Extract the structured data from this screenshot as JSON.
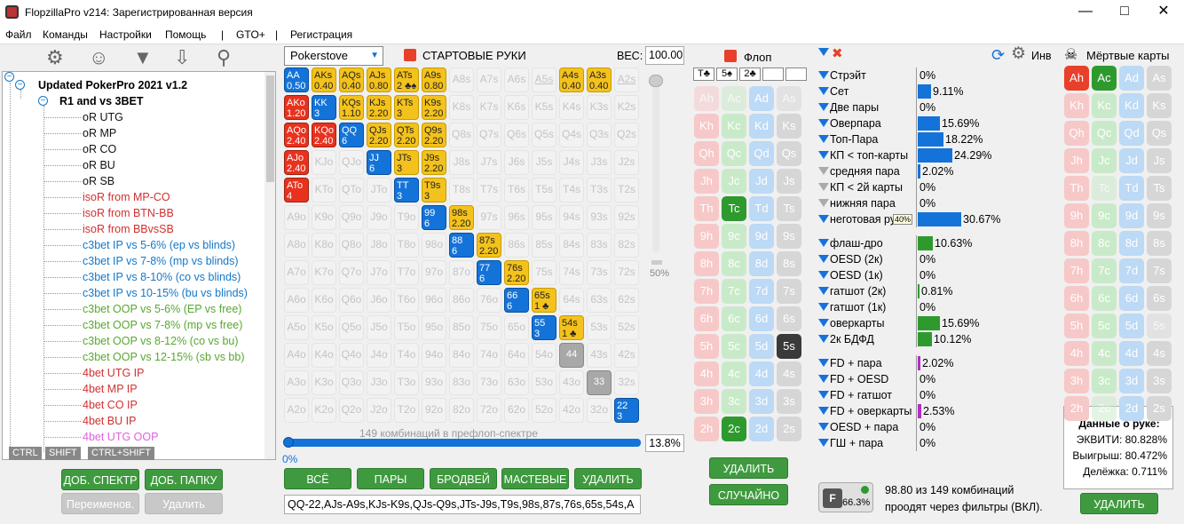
{
  "title": "FlopzillaPro v214: Зарегистрированная версия",
  "menu": [
    "Файл",
    "Команды",
    "Настройки",
    "Помощь",
    "|",
    "GTO+",
    "|",
    "Регистрация"
  ],
  "tree": {
    "root": "Updated PokerPro 2021 v1.2",
    "folder": "R1 and vs 3BET",
    "items": [
      {
        "t": "oR UTG",
        "c": "blk"
      },
      {
        "t": "oR MP",
        "c": "blk"
      },
      {
        "t": "oR CO",
        "c": "blk"
      },
      {
        "t": "oR BU",
        "c": "blk"
      },
      {
        "t": "oR SB",
        "c": "blk"
      },
      {
        "t": "isoR from MP-CO",
        "c": "red"
      },
      {
        "t": "isoR from BTN-BB",
        "c": "red"
      },
      {
        "t": "isoR from BBvsSB",
        "c": "red"
      },
      {
        "t": "c3bet IP vs 5-6% (ep vs blinds)",
        "c": "blu"
      },
      {
        "t": "c3bet IP vs 7-8% (mp vs blinds)",
        "c": "blu"
      },
      {
        "t": "c3bet IP vs 8-10% (co vs blinds)",
        "c": "blu"
      },
      {
        "t": "c3bet IP vs 10-15% (bu vs blinds)",
        "c": "blu"
      },
      {
        "t": "c3bet OOP vs 5-6% (EP vs free)",
        "c": "grn"
      },
      {
        "t": "c3bet OOP vs 7-8% (mp vs free)",
        "c": "grn"
      },
      {
        "t": "c3bet OOP vs 8-12% (co vs bu)",
        "c": "grn"
      },
      {
        "t": "c3bet OOP vs 12-15% (sb vs bb)",
        "c": "grn"
      },
      {
        "t": "4bet UTG IP",
        "c": "red"
      },
      {
        "t": "4bet MP IP",
        "c": "red"
      },
      {
        "t": "4bet CO IP",
        "c": "red"
      },
      {
        "t": "4bet BU IP",
        "c": "red"
      },
      {
        "t": "4bet UTG OOP",
        "c": "pnk"
      }
    ]
  },
  "keys": [
    "CTRL",
    "SHIFT",
    "CTRL+SHIFT"
  ],
  "left_buttons": [
    "ДОБ. СПЕКТР",
    "ДОБ. ПАПКУ",
    "Переименов.",
    "Удалить"
  ],
  "matrix": {
    "source": "Pokerstove",
    "heading": "СТАРТОВЫЕ РУКИ",
    "weight_label": "ВЕС:",
    "weight": "100.00",
    "slider_pct": "50%",
    "combos_text": "149 комбинаций в префлоп-спектре",
    "progress_left": "0%",
    "progress_right": "13.8%",
    "buttons": [
      "ВСЁ",
      "ПАРЫ",
      "БРОДВЕЙ",
      "МАСТЕВЫЕ",
      "УДАЛИТЬ"
    ],
    "range_text": "QQ-22,AJs-A9s,KJs-K9s,QJs-Q9s,JTs-J9s,T9s,98s,87s,76s,65s,54s,A",
    "ranks": [
      "A",
      "K",
      "Q",
      "J",
      "T",
      "9",
      "8",
      "7",
      "6",
      "5",
      "4",
      "3",
      "2"
    ],
    "cells": [
      {
        "k": "AA",
        "s": "bl",
        "v": "0.50"
      },
      {
        "k": "AKs",
        "s": "y",
        "v": "0.40"
      },
      {
        "k": "AQs",
        "s": "y",
        "v": "0.40"
      },
      {
        "k": "AJs",
        "s": "y",
        "v": "0.80"
      },
      {
        "k": "ATs",
        "s": "y",
        "v": "2 ♣♠"
      },
      {
        "k": "A9s",
        "s": "y",
        "v": "0.80"
      },
      {
        "k": "A4s",
        "s": "y",
        "v": "0.40"
      },
      {
        "k": "A3s",
        "s": "y",
        "v": "0.40"
      },
      {
        "k": "AKo",
        "s": "r",
        "v": "1.20"
      },
      {
        "k": "KK",
        "s": "bl",
        "v": "3"
      },
      {
        "k": "KQs",
        "s": "y",
        "v": "1.10"
      },
      {
        "k": "KJs",
        "s": "y",
        "v": "2.20"
      },
      {
        "k": "KTs",
        "s": "y",
        "v": "3"
      },
      {
        "k": "K9s",
        "s": "y",
        "v": "2.20"
      },
      {
        "k": "AQo",
        "s": "r",
        "v": "2.40"
      },
      {
        "k": "KQo",
        "s": "r",
        "v": "2.40"
      },
      {
        "k": "QQ",
        "s": "bl",
        "v": "6"
      },
      {
        "k": "QJs",
        "s": "y",
        "v": "2.20"
      },
      {
        "k": "QTs",
        "s": "y",
        "v": "2.20"
      },
      {
        "k": "Q9s",
        "s": "y",
        "v": "2.20"
      },
      {
        "k": "AJo",
        "s": "r",
        "v": "2.40"
      },
      {
        "k": "JJ",
        "s": "bl",
        "v": "6"
      },
      {
        "k": "JTs",
        "s": "y",
        "v": "3"
      },
      {
        "k": "J9s",
        "s": "y",
        "v": "2.20"
      },
      {
        "k": "ATo",
        "s": "r",
        "v": "4"
      },
      {
        "k": "TT",
        "s": "bl",
        "v": "3"
      },
      {
        "k": "T9s",
        "s": "y",
        "v": "3"
      },
      {
        "k": "99",
        "s": "bl",
        "v": "6"
      },
      {
        "k": "98s",
        "s": "y",
        "v": "2.20"
      },
      {
        "k": "88",
        "s": "bl",
        "v": "6"
      },
      {
        "k": "87s",
        "s": "y",
        "v": "2.20"
      },
      {
        "k": "77",
        "s": "bl",
        "v": "6"
      },
      {
        "k": "76s",
        "s": "y",
        "v": "2.20"
      },
      {
        "k": "66",
        "s": "bl",
        "v": "6"
      },
      {
        "k": "65s",
        "s": "y",
        "v": "1 ♣"
      },
      {
        "k": "55",
        "s": "bl",
        "v": "3"
      },
      {
        "k": "54s",
        "s": "y",
        "v": "1 ♣"
      },
      {
        "k": "44",
        "s": "g",
        "v": ""
      },
      {
        "k": "33",
        "s": "g",
        "v": ""
      },
      {
        "k": "22",
        "s": "bl",
        "v": "3"
      }
    ],
    "underlined": [
      "A5s",
      "A2s"
    ]
  },
  "flop": {
    "title": "Флоп",
    "slots": [
      "T♣",
      "5♠",
      "2♣",
      "",
      ""
    ],
    "buttons": [
      "УДАЛИТЬ",
      "СЛУЧАЙНО"
    ],
    "on": [
      "Tc",
      "2c",
      "5s"
    ],
    "dim": [
      "Ah",
      "Ac",
      "As"
    ]
  },
  "stats": {
    "header_label": "Инв",
    "rows": [
      {
        "n": "Стрэйт",
        "v": "0%",
        "p": 0,
        "col": "#1473d8"
      },
      {
        "n": "Сет",
        "v": "9.11%",
        "p": 9.11,
        "col": "#1473d8"
      },
      {
        "n": "Две пары",
        "v": "0%",
        "p": 0,
        "col": "#1473d8"
      },
      {
        "n": "Оверпара",
        "v": "15.69%",
        "p": 15.69,
        "col": "#1473d8"
      },
      {
        "n": "Топ-Пара",
        "v": "18.22%",
        "p": 18.22,
        "col": "#1473d8"
      },
      {
        "n": "КП < топ-карты",
        "v": "24.29%",
        "p": 24.29,
        "col": "#1473d8"
      },
      {
        "n": "средняя пара",
        "v": "2.02%",
        "p": 2.02,
        "col": "#1473d8",
        "gr": true
      },
      {
        "n": "КП < 2й карты",
        "v": "0%",
        "p": 0,
        "col": "#1473d8",
        "gr": true
      },
      {
        "n": "нижняя пара",
        "v": "0%",
        "p": 0,
        "col": "#1473d8",
        "gr": true
      },
      {
        "n": "неготовая рука",
        "v": "30.67%",
        "p": 30.67,
        "col": "#1473d8",
        "tip": "40%"
      },
      {
        "gap": true
      },
      {
        "n": "флаш-дро",
        "v": "10.63%",
        "p": 10.63,
        "col": "#2e9a2e"
      },
      {
        "n": "OESD (2к)",
        "v": "0%",
        "p": 0,
        "col": "#2e9a2e"
      },
      {
        "n": "OESD (1к)",
        "v": "0%",
        "p": 0,
        "col": "#2e9a2e"
      },
      {
        "n": "гатшот (2к)",
        "v": "0.81%",
        "p": 0.81,
        "col": "#2e9a2e"
      },
      {
        "n": "гатшот (1к)",
        "v": "0%",
        "p": 0,
        "col": "#2e9a2e"
      },
      {
        "n": "оверкарты",
        "v": "15.69%",
        "p": 15.69,
        "col": "#2e9a2e"
      },
      {
        "n": "2к БДФД",
        "v": "10.12%",
        "p": 10.12,
        "col": "#2e9a2e"
      },
      {
        "gap": true
      },
      {
        "n": "FD + пара",
        "v": "2.02%",
        "p": 2.02,
        "col": "#b030c0"
      },
      {
        "n": "FD + OESD",
        "v": "0%",
        "p": 0,
        "col": "#b030c0"
      },
      {
        "n": "FD + гатшот",
        "v": "0%",
        "p": 0,
        "col": "#b030c0"
      },
      {
        "n": "FD + оверкарты",
        "v": "2.53%",
        "p": 2.53,
        "col": "#b030c0"
      },
      {
        "n": "OESD + пара",
        "v": "0%",
        "p": 0,
        "col": "#b030c0"
      },
      {
        "n": "ГШ + пара",
        "v": "0%",
        "p": 0,
        "col": "#b030c0"
      }
    ],
    "filter_pct": "66.3%",
    "summary1": "98.80 из 149 комбинаций",
    "summary2": "проодят через фильтры (ВКЛ)."
  },
  "dead": {
    "title": "Мёртвые карты",
    "on": [
      "Ah",
      "Ac"
    ],
    "dim": [
      "Tc",
      "5s",
      "2c"
    ],
    "info_title": "Данные о руке:",
    "equity": "ЭКВИТИ: 80.828%",
    "win": "Выигрыш: 80.472%",
    "tie": "Делёжка: 0.711%",
    "button": "УДАЛИТЬ"
  }
}
